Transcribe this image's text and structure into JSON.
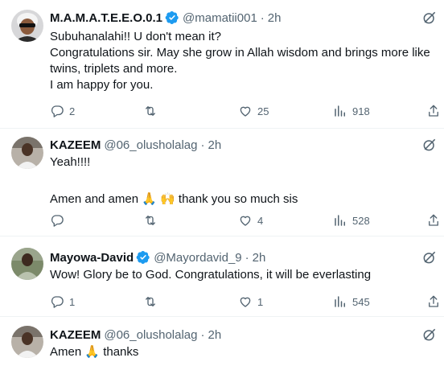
{
  "tweets": [
    {
      "name": "M.A.M.A.T.E.E.O.0.1",
      "handle": "@mamatii001",
      "time": "2h",
      "verified": true,
      "body": [
        "Subuhanalahi!! U don't mean it?",
        "Congratulations sir. May she grow in Allah wisdom and brings more like twins, triplets and more.",
        "I am happy for you."
      ],
      "stats": {
        "replies": "2",
        "retweets": "",
        "likes": "25",
        "views": "918"
      }
    },
    {
      "name": "KAZEEM",
      "handle": "@06_olusholalag",
      "time": "2h",
      "verified": false,
      "body": [
        "Yeah!!!!",
        "",
        "Amen and amen 🙏 🙌 thank you so much sis"
      ],
      "stats": {
        "replies": "",
        "retweets": "",
        "likes": "4",
        "views": "528"
      }
    },
    {
      "name": "Mayowa-David",
      "handle": "@Mayordavid_9",
      "time": "2h",
      "verified": true,
      "body": [
        "Wow! Glory be to God. Congratulations, it will be everlasting"
      ],
      "stats": {
        "replies": "1",
        "retweets": "",
        "likes": "1",
        "views": "545"
      }
    },
    {
      "name": "KAZEEM",
      "handle": "@06_olusholalag",
      "time": "2h",
      "verified": false,
      "body": [
        "Amen 🙏 thanks"
      ],
      "stats": {
        "replies": "",
        "retweets": "",
        "likes": "",
        "views": ""
      }
    }
  ],
  "separator": "·",
  "icons": {
    "reply": "reply-icon",
    "retweet": "retweet-icon",
    "like": "heart-icon",
    "views": "views-icon",
    "share": "share-icon",
    "grok": "grok-icon",
    "verified": "verified-badge-icon"
  },
  "colors": {
    "text": "#0f1419",
    "secondary": "#536471",
    "verified": "#1d9bf0",
    "divider": "#eff3f4"
  }
}
